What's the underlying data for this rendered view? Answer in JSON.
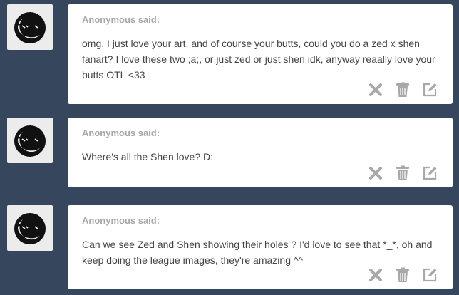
{
  "posts": [
    {
      "asker_label": "Anonymous said:",
      "question": "omg, I just love your art, and of course your butts, could you do a zed x shen fanart? I love these two ;a;, or just zed or just shen idk, anyway reaally love your butts OTL <33"
    },
    {
      "asker_label": "Anonymous said:",
      "question": "Where's all the Shen love? D:"
    },
    {
      "asker_label": "Anonymous said:",
      "question": "Can we see Zed and Shen showing their holes ? I'd love to see that *_*, oh and keep doing the league images, they're amazing ^^"
    }
  ],
  "icons": {
    "avatar": "anonymous-sunglasses-avatar",
    "delete": "x-icon",
    "trash": "trash-icon",
    "edit": "edit-icon"
  },
  "colors": {
    "background": "#36465d",
    "card": "#ffffff",
    "asker": "#a8a8a8",
    "text": "#444444",
    "icon": "#a9a9a9"
  }
}
